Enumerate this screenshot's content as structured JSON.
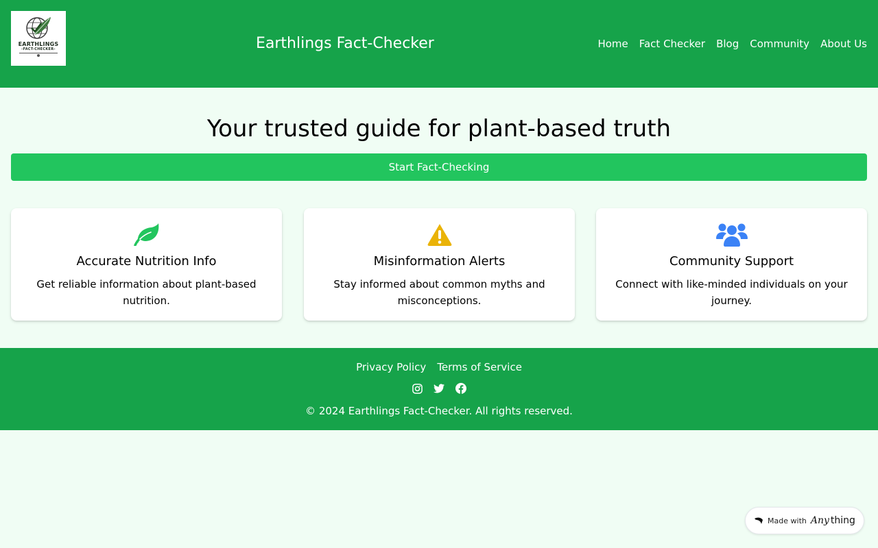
{
  "header": {
    "logo": {
      "line1": "EARTHLINGS",
      "line2": "-FACT-CHECKER-"
    },
    "title": "Earthlings Fact-Checker",
    "nav": [
      "Home",
      "Fact Checker",
      "Blog",
      "Community",
      "About Us"
    ]
  },
  "hero": {
    "title": "Your trusted guide for plant-based truth",
    "cta_label": "Start Fact-Checking"
  },
  "features": [
    {
      "icon": "leaf-icon",
      "icon_color": "#22c55e",
      "title": "Accurate Nutrition Info",
      "description": "Get reliable information about plant-based nutrition."
    },
    {
      "icon": "warning-icon",
      "icon_color": "#eab308",
      "title": "Misinformation Alerts",
      "description": "Stay informed about common myths and misconceptions."
    },
    {
      "icon": "users-icon",
      "icon_color": "#3b82f6",
      "title": "Community Support",
      "description": "Connect with like-minded individuals on your journey."
    }
  ],
  "footer": {
    "links": [
      "Privacy Policy",
      "Terms of Service"
    ],
    "social": [
      "instagram-icon",
      "twitter-icon",
      "facebook-icon"
    ],
    "copyright": "© 2024 Earthlings Fact-Checker. All rights reserved."
  },
  "badge": {
    "prefix": "Made with",
    "brand_italic": "Any",
    "brand_rest": "thing"
  },
  "colors": {
    "primary": "#16a34a",
    "accent": "#22c55e",
    "background": "#f0fdf4"
  }
}
